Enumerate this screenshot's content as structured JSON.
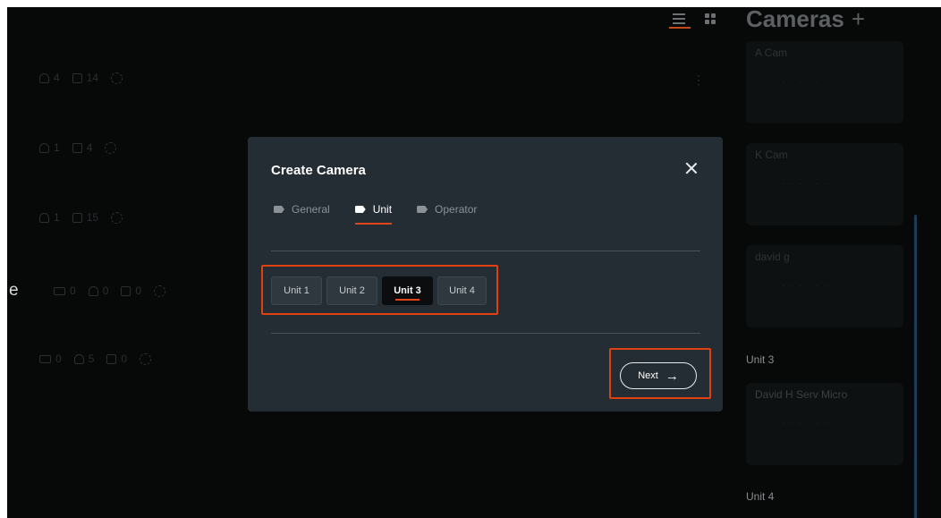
{
  "background": {
    "rows": [
      {
        "stats": [
          "4",
          "14"
        ]
      },
      {
        "stats": [
          "1",
          "4"
        ]
      },
      {
        "stats": [
          "1",
          "15"
        ]
      },
      {
        "stats": [
          "0",
          "0",
          "0"
        ]
      },
      {
        "stats": [
          "0",
          "5",
          "0"
        ]
      }
    ],
    "partial_letter": "e",
    "cameras_title": "Cameras",
    "cameras_plus": "+",
    "camera_cards": [
      {
        "name": "A Cam"
      },
      {
        "name": "K Cam"
      },
      {
        "name": "david g"
      }
    ],
    "unit3_label": "Unit 3",
    "unit3_card": {
      "name": "David H Serv Micro"
    },
    "unit4_label": "Unit 4"
  },
  "modal": {
    "title": "Create Camera",
    "tabs": [
      {
        "label": "General",
        "active": false
      },
      {
        "label": "Unit",
        "active": true
      },
      {
        "label": "Operator",
        "active": false
      }
    ],
    "units": [
      "Unit 1",
      "Unit 2",
      "Unit 3",
      "Unit 4"
    ],
    "selected_unit": "Unit 3",
    "next_label": "Next",
    "highlight_color": "#e0400f",
    "accent_color": "#e0461a"
  }
}
